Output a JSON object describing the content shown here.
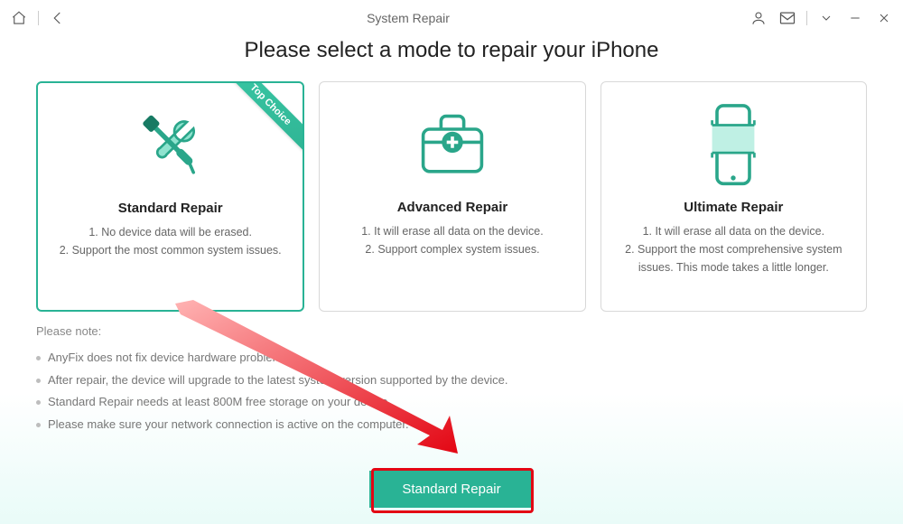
{
  "window": {
    "title": "System Repair"
  },
  "heading": "Please select a mode to repair your iPhone",
  "cards": [
    {
      "ribbon": "Top Choice",
      "title": "Standard Repair",
      "line1": "1. No device data will be erased.",
      "line2": "2. Support the most common system issues."
    },
    {
      "title": "Advanced Repair",
      "line1": "1. It will erase all data on the device.",
      "line2": "2. Support complex system issues."
    },
    {
      "title": "Ultimate Repair",
      "line1": "1. It will erase all data on the device.",
      "line2": "2. Support the most comprehensive system issues. This mode takes a little longer."
    }
  ],
  "notes": {
    "label": "Please note:",
    "items": [
      "AnyFix does not fix device hardware problems.",
      "After repair, the device will upgrade to the latest system version supported by the device.",
      "Standard Repair needs at least 800M free storage on your device.",
      "Please make sure your network connection is active on the computer."
    ]
  },
  "cta": "Standard Repair",
  "colors": {
    "accent": "#29b395"
  }
}
